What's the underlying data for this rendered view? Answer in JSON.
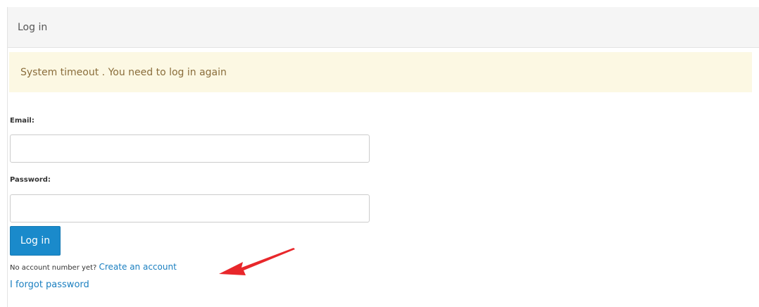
{
  "panel": {
    "title": "Log in"
  },
  "alert": {
    "message": "System timeout . You need to log in again"
  },
  "form": {
    "email_label": "Email:",
    "email_value": "",
    "password_label": "Password:",
    "password_value": "",
    "submit_label": "Log in"
  },
  "signup": {
    "prompt": "No account number yet?",
    "link_label": "Create an account"
  },
  "forgot": {
    "link_label": "I forgot password"
  },
  "colors": {
    "primary_button": "#1a8acb",
    "alert_background": "#fcf8e3",
    "alert_text": "#8a6d3b",
    "link": "#1a7fc0",
    "annotation_arrow": "#e8272b"
  },
  "icons": {
    "annotation": "red-arrow-icon"
  }
}
